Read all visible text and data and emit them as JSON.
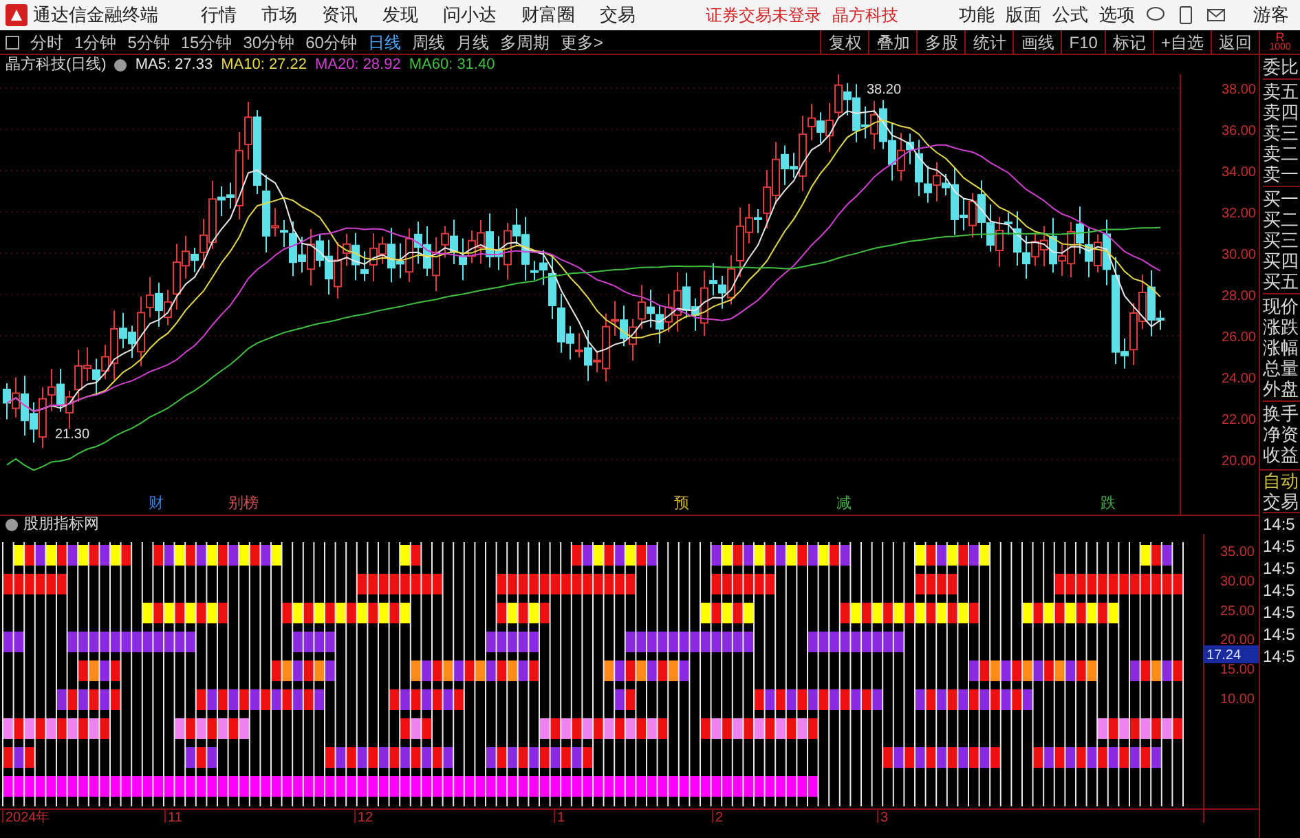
{
  "app": {
    "title": "通达信金融终端"
  },
  "menu": [
    "行情",
    "市场",
    "资讯",
    "发现",
    "问小达",
    "财富圈",
    "交易"
  ],
  "status": [
    "证券交易未登录",
    "晶方科技"
  ],
  "right_menu": [
    "功能",
    "版面",
    "公式",
    "选项"
  ],
  "user": "游客",
  "periods": [
    {
      "label": "分时",
      "selected": false
    },
    {
      "label": "1分钟",
      "selected": false
    },
    {
      "label": "5分钟",
      "selected": false
    },
    {
      "label": "15分钟",
      "selected": false
    },
    {
      "label": "30分钟",
      "selected": false
    },
    {
      "label": "60分钟",
      "selected": false
    },
    {
      "label": "日线",
      "selected": true
    },
    {
      "label": "周线",
      "selected": false
    },
    {
      "label": "月线",
      "selected": false
    },
    {
      "label": "多周期",
      "selected": false
    },
    {
      "label": "更多>",
      "selected": false
    }
  ],
  "tools": [
    "复权",
    "叠加",
    "多股",
    "统计",
    "画线",
    "F10",
    "标记",
    "+自选",
    "返回"
  ],
  "corner": [
    "R",
    "1000"
  ],
  "chart": {
    "title": "晶方科技(日线)",
    "indicators": [
      {
        "label": "MA5: 27.33",
        "color": "#e8e8e8"
      },
      {
        "label": "MA10: 27.22",
        "color": "#e6d84a"
      },
      {
        "label": "MA20: 28.92",
        "color": "#d040d0"
      },
      {
        "label": "MA60: 31.40",
        "color": "#40c040"
      }
    ],
    "yticks": [
      "38.00",
      "36.00",
      "34.00",
      "32.00",
      "30.00",
      "28.00",
      "26.00",
      "24.00",
      "22.00",
      "20.00"
    ],
    "high_label": "38.20",
    "low_label": "21.30",
    "events": [
      {
        "label": "财",
        "color": "#3a7bd5"
      },
      {
        "label": "别榜",
        "color": "#d05050"
      },
      {
        "label": "预",
        "color": "#d0b030"
      },
      {
        "label": "减",
        "color": "#40b040"
      },
      {
        "label": "跌",
        "color": "#40b040"
      }
    ]
  },
  "quote_labels": [
    [
      "委比"
    ],
    [
      "卖五",
      "卖四",
      "卖三",
      "卖二",
      "卖一"
    ],
    [
      "买一",
      "买二",
      "买三",
      "买四",
      "买五"
    ],
    [
      "现价",
      "涨跌",
      "涨幅",
      "总量",
      "外盘"
    ],
    [
      "换手",
      "净资",
      "收益"
    ]
  ],
  "indicator": {
    "title": "股朋指标网",
    "yticks": [
      "35.00",
      "30.00",
      "25.00",
      "20.00",
      "15.00",
      "10.00"
    ],
    "current": "17.24",
    "dates": [
      "2024年",
      "11",
      "12",
      "1",
      "2",
      "3"
    ]
  },
  "trade": {
    "mode": "自动",
    "label": "交易",
    "times": [
      "14:5",
      "14:5",
      "14:5",
      "14:5",
      "14:5",
      "14:5",
      "14:5"
    ]
  }
}
